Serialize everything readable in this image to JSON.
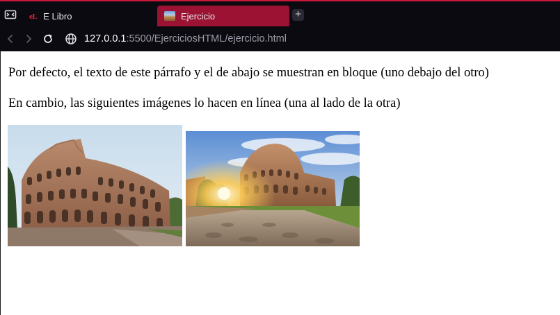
{
  "browser": {
    "tabs": [
      {
        "label": "E Libro",
        "favicon": "elibro-logo",
        "favicon_text": "eL",
        "active": false
      },
      {
        "label": "Ejercicio",
        "favicon": "colosseum-thumbnail",
        "active": true
      }
    ],
    "new_tab_label": "+",
    "address": {
      "host": "127.0.0.1",
      "rest": ":5500/EjerciciosHTML/ejercicio.html"
    },
    "colors": {
      "chrome_background": "#0b0a10",
      "active_tab": "#9b1232",
      "accent": "#c8183c"
    }
  },
  "page": {
    "paragraphs": [
      "Por defecto, el texto de este párrafo y el de abajo se muestran en bloque (uno debajo del otro)",
      "En cambio, las siguientes imágenes lo hacen en línea (una al lado de la otra)"
    ],
    "images": [
      {
        "name": "colosseum-daylight-photo"
      },
      {
        "name": "colosseum-sunrise-photo"
      }
    ]
  }
}
